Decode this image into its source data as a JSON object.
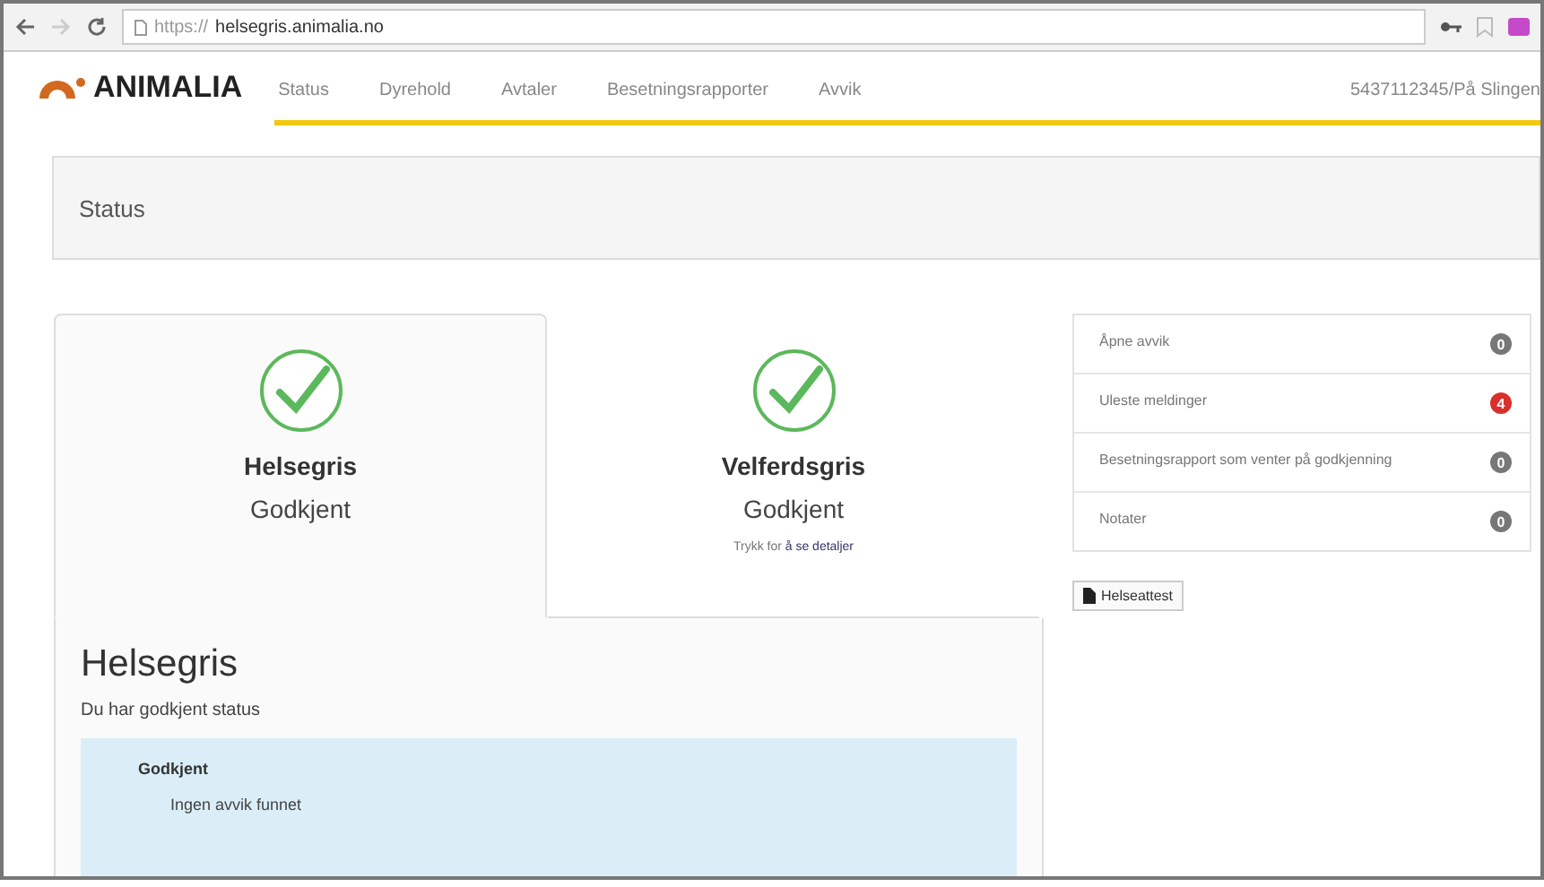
{
  "browser": {
    "url_prefix": "https://",
    "url_host": "helsegris.animalia.no"
  },
  "header": {
    "logo": "ANIMALIA",
    "nav": [
      "Status",
      "Dyrehold",
      "Avtaler",
      "Besetningsrapporter",
      "Avvik"
    ],
    "user": "5437112345/På Slingen"
  },
  "page_title": "Status",
  "tabs": [
    {
      "title": "Helsegris",
      "status": "Godkjent",
      "selected": true
    },
    {
      "title": "Velferdsgris",
      "status": "Godkjent",
      "hint": "Trykk for ",
      "link": "å se detaljer",
      "selected": false
    }
  ],
  "panel": {
    "heading": "Helsegris",
    "text": "Du har godkjent status",
    "box_title": "Godkjent",
    "box_item": "Ingen avvik funnet"
  },
  "sidebar": [
    {
      "label": "Åpne avvik",
      "count": "0",
      "kind": "neutral"
    },
    {
      "label": "Uleste meldinger",
      "count": "4",
      "kind": "alert"
    },
    {
      "label": "Besetningsrapport som venter på godkjenning",
      "count": "0",
      "kind": "neutral"
    },
    {
      "label": "Notater",
      "count": "0",
      "kind": "neutral"
    }
  ],
  "button": "Helseattest"
}
